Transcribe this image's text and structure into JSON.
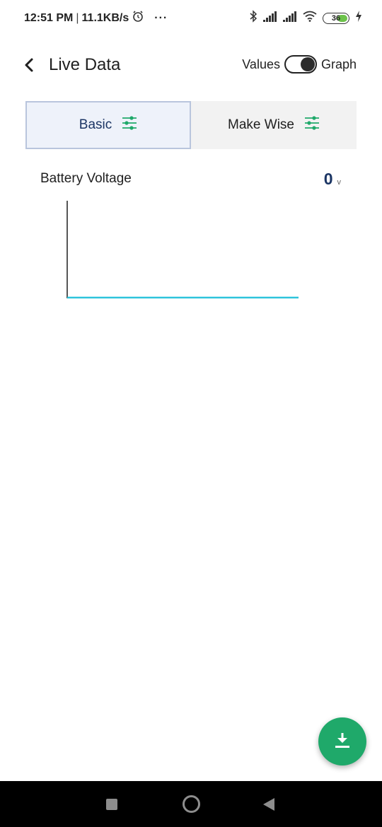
{
  "status_bar": {
    "time": "12:51 PM",
    "separator": "|",
    "network_speed": "11.1KB/s",
    "more": "···",
    "battery_level": "36",
    "icons": [
      "alarm-icon",
      "bluetooth-icon",
      "signal-icon",
      "signal-icon",
      "wifi-icon",
      "battery-icon",
      "charging-icon"
    ]
  },
  "header": {
    "title": "Live Data",
    "toggle_left_label": "Values",
    "toggle_right_label": "Graph",
    "toggle_state": "Graph"
  },
  "tabs": [
    {
      "label": "Basic",
      "icon": "sliders-icon",
      "active": true
    },
    {
      "label": "Make Wise",
      "icon": "sliders-icon",
      "active": false
    }
  ],
  "parameter": {
    "label": "Battery Voltage",
    "value": "0",
    "unit": "v"
  },
  "chart_data": {
    "type": "line",
    "series": [
      {
        "values": [
          0,
          0,
          0,
          0,
          0,
          0,
          0,
          0,
          0,
          0
        ]
      }
    ],
    "xlabel": "",
    "ylabel": "",
    "line_color": "#2ec4dc"
  },
  "fab": {
    "icon": "download-icon",
    "color": "#1fa96a"
  },
  "colors": {
    "accent_green": "#1fa96a",
    "tab_active_text": "#1b3564"
  }
}
